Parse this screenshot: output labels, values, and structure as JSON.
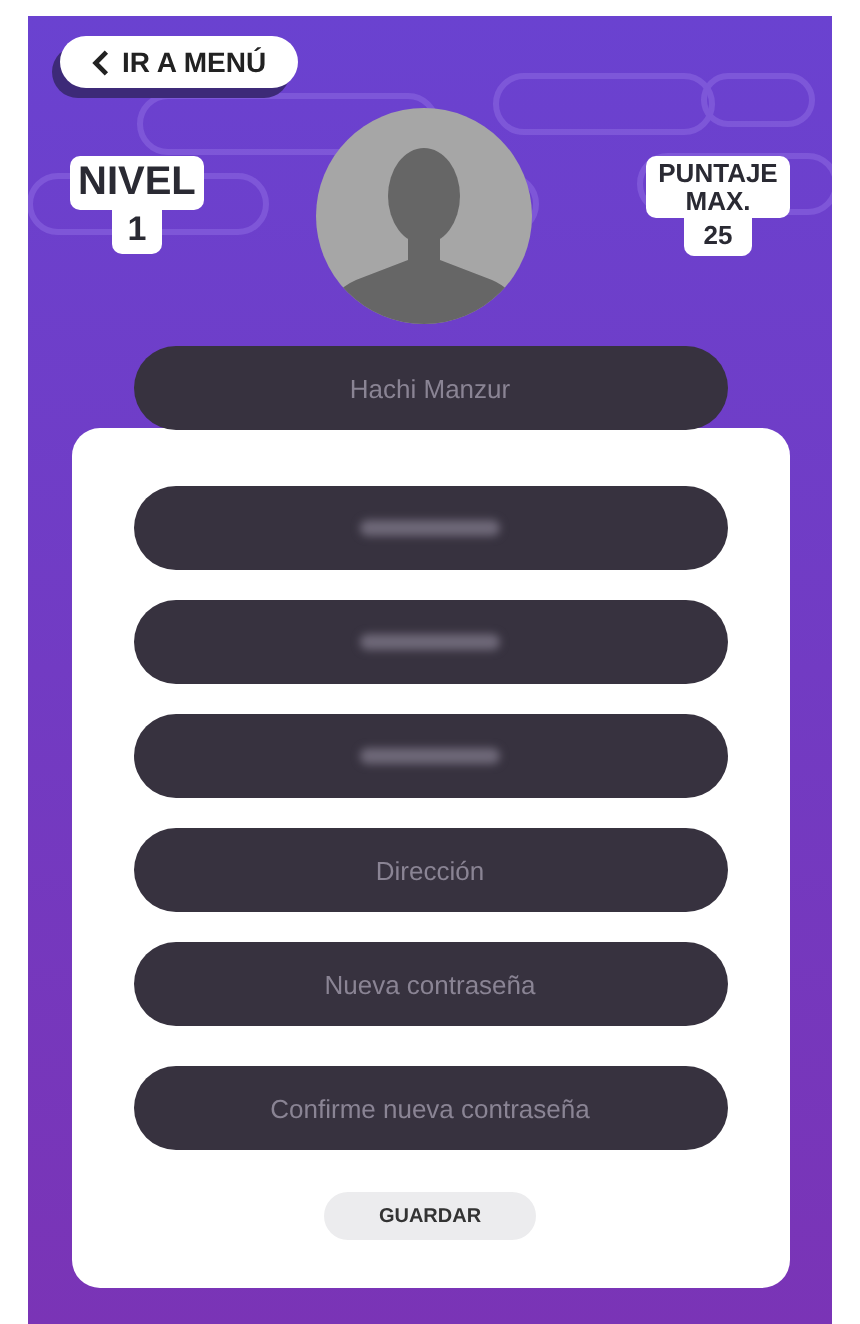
{
  "back_button": {
    "label": "IR A MENÚ"
  },
  "level_badge": {
    "title": "NIVEL",
    "value": "1"
  },
  "score_badge": {
    "title": "PUNTAJE MAX.",
    "value": "25"
  },
  "name_field": {
    "value": "Hachi Manzur"
  },
  "fields": [
    {
      "blurred": true
    },
    {
      "blurred": true
    },
    {
      "blurred": true
    },
    {
      "blurred": false,
      "placeholder": "Dirección"
    },
    {
      "blurred": false,
      "placeholder": "Nueva contraseña"
    },
    {
      "blurred": false,
      "placeholder": "Confirme nueva contraseña"
    }
  ],
  "save_button": {
    "label": "GUARDAR"
  }
}
